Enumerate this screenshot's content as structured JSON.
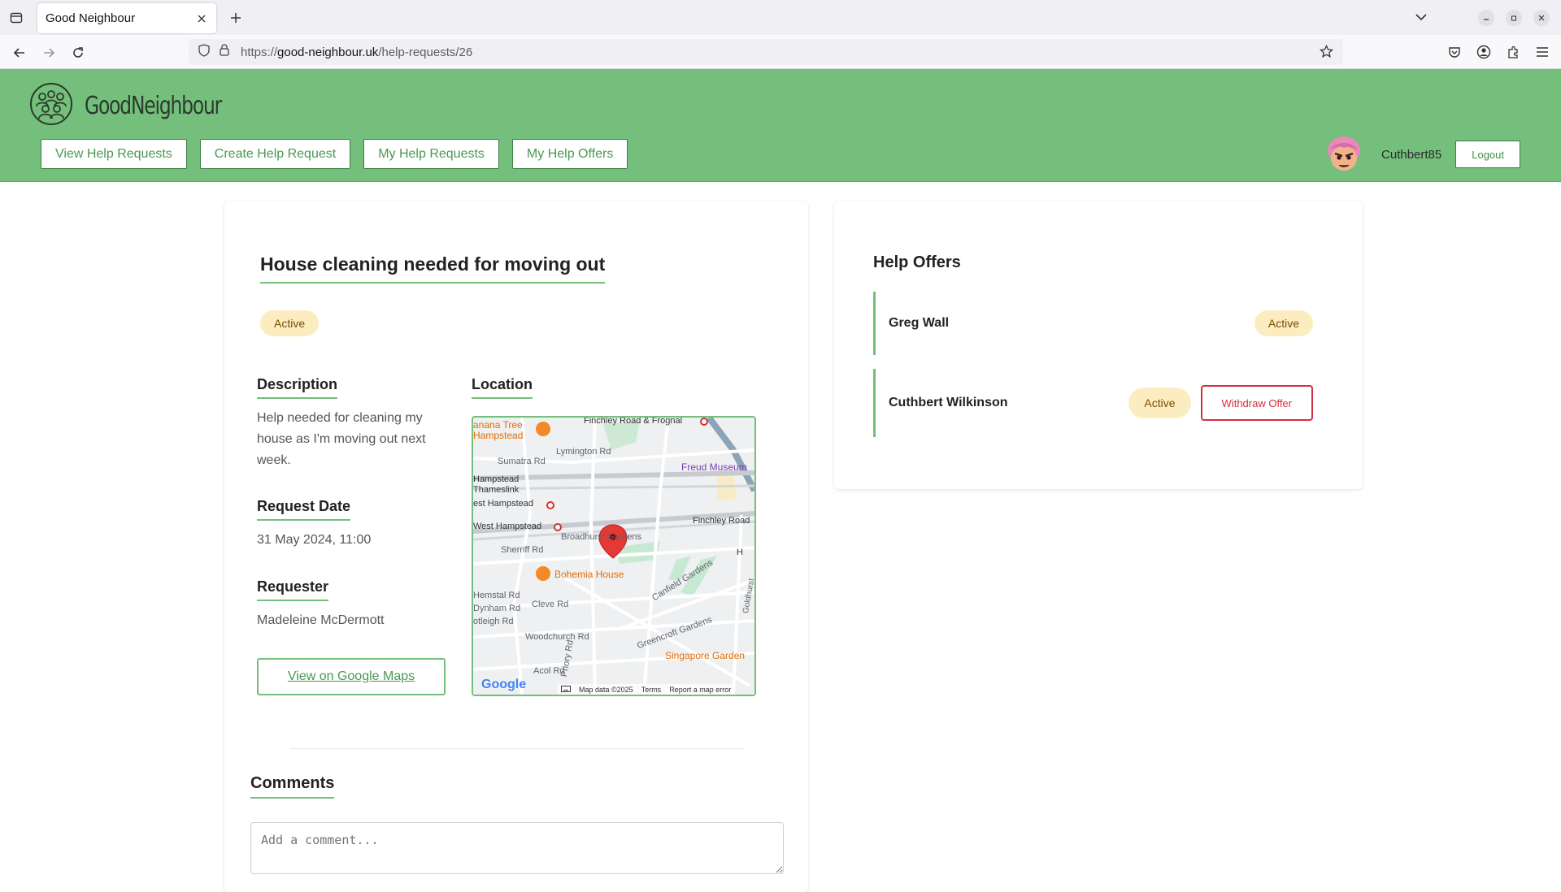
{
  "browser": {
    "tab_title": "Good Neighbour",
    "url_prefix": "https://",
    "url_domain": "good-neighbour.uk",
    "url_path": "/help-requests/26"
  },
  "site": {
    "logo_text": "GoodNeighbour",
    "nav": [
      "View Help Requests",
      "Create Help Request",
      "My Help Requests",
      "My Help Offers"
    ],
    "username": "Cuthbert85",
    "logout_label": "Logout",
    "accent_color": "#74bf7b"
  },
  "request": {
    "title": "House cleaning needed for moving out",
    "status": "Active",
    "description_heading": "Description",
    "description": "Help needed for cleaning my house as I'm moving out next week.",
    "date_heading": "Request Date",
    "date": "31 May 2024, 11:00",
    "requester_heading": "Requester",
    "requester": "Madeleine McDermott",
    "location_heading": "Location",
    "maps_button": "View on Google Maps"
  },
  "map": {
    "labels": {
      "banana": "anana Tree",
      "banana2": "Hampstead",
      "finchley_frognal": "Finchley Road & Frognal",
      "lymington": "Lymington Rd",
      "sumatra": "Sumatra Rd",
      "freud": "Freud Museum",
      "hampstead_thameslink": "Hampstead",
      "thameslink": "Thameslink",
      "west_hampstead_1": "est Hampstead",
      "west_hampstead_2": "West Hampstead",
      "finchley_road": "Finchley Road",
      "broadhurst": "Broadhurst Gardens",
      "sherriff": "Sherriff Rd",
      "bohemia": "Bohemia House",
      "hemstal": "Hemstal Rd",
      "dynham": "Dynham Rd",
      "cotleigh": "otleigh Rd",
      "cleve": "Cleve Rd",
      "canfield": "Canfield Gardens",
      "woodchurch": "Woodchurch Rd",
      "greencroft": "Greencroft Gardens",
      "priory": "Priory Rd",
      "acol": "Acol Rd",
      "singapore": "Singapore Garden",
      "goldhurst": "Goldhurst",
      "h": "H"
    },
    "footer": {
      "google": "Google",
      "map_data": "Map data ©2025",
      "terms": "Terms",
      "report": "Report a map error"
    }
  },
  "comments": {
    "heading": "Comments",
    "placeholder": "Add a comment..."
  },
  "offers": {
    "heading": "Help Offers",
    "items": [
      {
        "name": "Greg Wall",
        "status": "Active"
      },
      {
        "name": "Cuthbert Wilkinson",
        "status": "Active",
        "action": "Withdraw Offer"
      }
    ]
  }
}
